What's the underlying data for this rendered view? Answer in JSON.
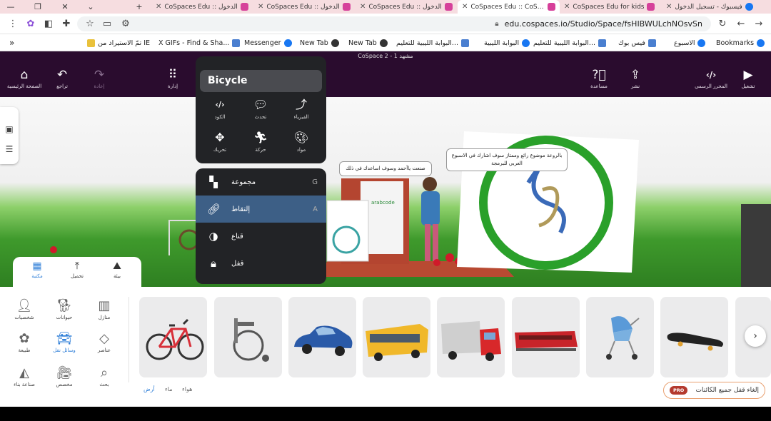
{
  "browser": {
    "tabs": [
      {
        "title": "فيسبوك - تسجيل الدخول",
        "icon": "facebook-icon",
        "active": false
      },
      {
        "title": "CoSpaces Edu for kids",
        "icon": "cospaces-icon",
        "active": false
      },
      {
        "title": "CoSpaces Edu :: CoSpaces",
        "icon": "cospaces-icon",
        "active": true
      },
      {
        "title": "CoSpaces Edu :: الدخول",
        "icon": "cospaces-icon",
        "active": false
      },
      {
        "title": "CoSpaces Edu :: الدخول",
        "icon": "cospaces-icon",
        "active": false
      },
      {
        "title": "CoSpaces Edu :: الدخول",
        "icon": "cospaces-icon",
        "active": false
      }
    ],
    "new_tab_symbol": "+",
    "url": "edu.cospaces.io/Studio/Space/fsHIBWULchNOsvSn",
    "bookmarks": [
      {
        "label": "Bookmarks",
        "icon": "facebook-icon"
      },
      {
        "label": "الاسبوع",
        "icon": "facebook-icon"
      },
      {
        "label": "فيس بوك",
        "icon": "page-icon"
      },
      {
        "label": "البوابة الليبية للتعليم...",
        "icon": "page-icon"
      },
      {
        "label": "البوابة الليبية",
        "icon": "facebook-icon"
      },
      {
        "label": "البوابة الليبية للتعليم...",
        "icon": "page-icon"
      },
      {
        "label": "New Tab",
        "icon": "globe-icon"
      },
      {
        "label": "New Tab",
        "icon": "globe-icon"
      },
      {
        "label": "Messenger",
        "icon": "facebook-icon"
      },
      {
        "label": "X GIFs - Find & Sha...",
        "icon": "page-icon"
      },
      {
        "label": "تمّ الاستيراد من IE",
        "icon": "folder-icon"
      }
    ],
    "bookmarks_more": "»"
  },
  "cospaces": {
    "scene_title": "CoSpace 2 - مشهد 1",
    "toolbar_left": [
      {
        "label": "الصفحة الرئيسية",
        "icon": "home-icon"
      },
      {
        "label": "تراجع",
        "icon": "undo-icon"
      },
      {
        "label": "إعادة",
        "icon": "redo-icon"
      },
      {
        "label": "إدارة",
        "icon": "grid-icon"
      }
    ],
    "toolbar_right": [
      {
        "label": "مساعدة",
        "icon": "help-icon"
      },
      {
        "label": "نشر",
        "icon": "share-icon"
      },
      {
        "label": "المحرر الرسمي",
        "icon": "code-icon"
      },
      {
        "label": "تشغيل",
        "icon": "play-icon"
      }
    ],
    "context_menu": {
      "title": "Bicycle",
      "actions": [
        {
          "label": "الكود",
          "icon": "code-icon"
        },
        {
          "label": "تحدث",
          "icon": "speech-icon"
        },
        {
          "label": "الفيزياء",
          "icon": "physics-icon"
        },
        {
          "label": "تحريك",
          "icon": "move-icon"
        },
        {
          "label": "حركة",
          "icon": "animation-icon"
        },
        {
          "label": "مواد",
          "icon": "palette-icon"
        }
      ],
      "rows": [
        {
          "label": "مجموعة",
          "key": "G",
          "icon": "group-icon"
        },
        {
          "label": "إلتقاط",
          "key": "A",
          "icon": "attach-icon"
        },
        {
          "label": "قناع",
          "key": "",
          "icon": "mask-icon"
        },
        {
          "label": "قفل",
          "key": "",
          "icon": "lock-icon"
        }
      ]
    },
    "speech_bubbles": [
      "صنعت ياأحمد وسوف اساعدك في ذلك",
      "بالروعة موضوع رائع وممتاز سوف اشارك في الاسبوع العربي للبرمجة"
    ],
    "library_tabs": [
      {
        "label": "مكتبة",
        "icon": "library-icon",
        "active": true
      },
      {
        "label": "تحميل",
        "icon": "upload-icon",
        "active": false
      },
      {
        "label": "بيئة",
        "icon": "environment-icon",
        "active": false
      }
    ],
    "categories": [
      {
        "label": "شخصيات",
        "icon": "person-icon",
        "active": false
      },
      {
        "label": "حيوانات",
        "icon": "animal-icon",
        "active": false
      },
      {
        "label": "منازل",
        "icon": "building-icon",
        "active": false
      },
      {
        "label": "طبيعة",
        "icon": "nature-icon",
        "active": false
      },
      {
        "label": "وسائل نقل",
        "icon": "car-icon",
        "active": true
      },
      {
        "label": "عناصر",
        "icon": "gem-icon",
        "active": false
      },
      {
        "label": "صناعة بناء",
        "icon": "shapes-icon",
        "active": false
      },
      {
        "label": "مخصص",
        "icon": "camera-icon",
        "active": false
      },
      {
        "label": "بحث",
        "icon": "search-icon",
        "active": false
      }
    ],
    "subtabs": [
      {
        "label": "أرض",
        "active": true
      },
      {
        "label": "ماء",
        "active": false
      },
      {
        "label": "هواء",
        "active": false
      }
    ],
    "items": [
      "bicycle",
      "wheelchair",
      "car",
      "bus",
      "truck",
      "train",
      "stroller",
      "skateboard"
    ],
    "unlock_button": "إلغاء قفل جميع الكائنات",
    "pro_badge": "PRO"
  }
}
